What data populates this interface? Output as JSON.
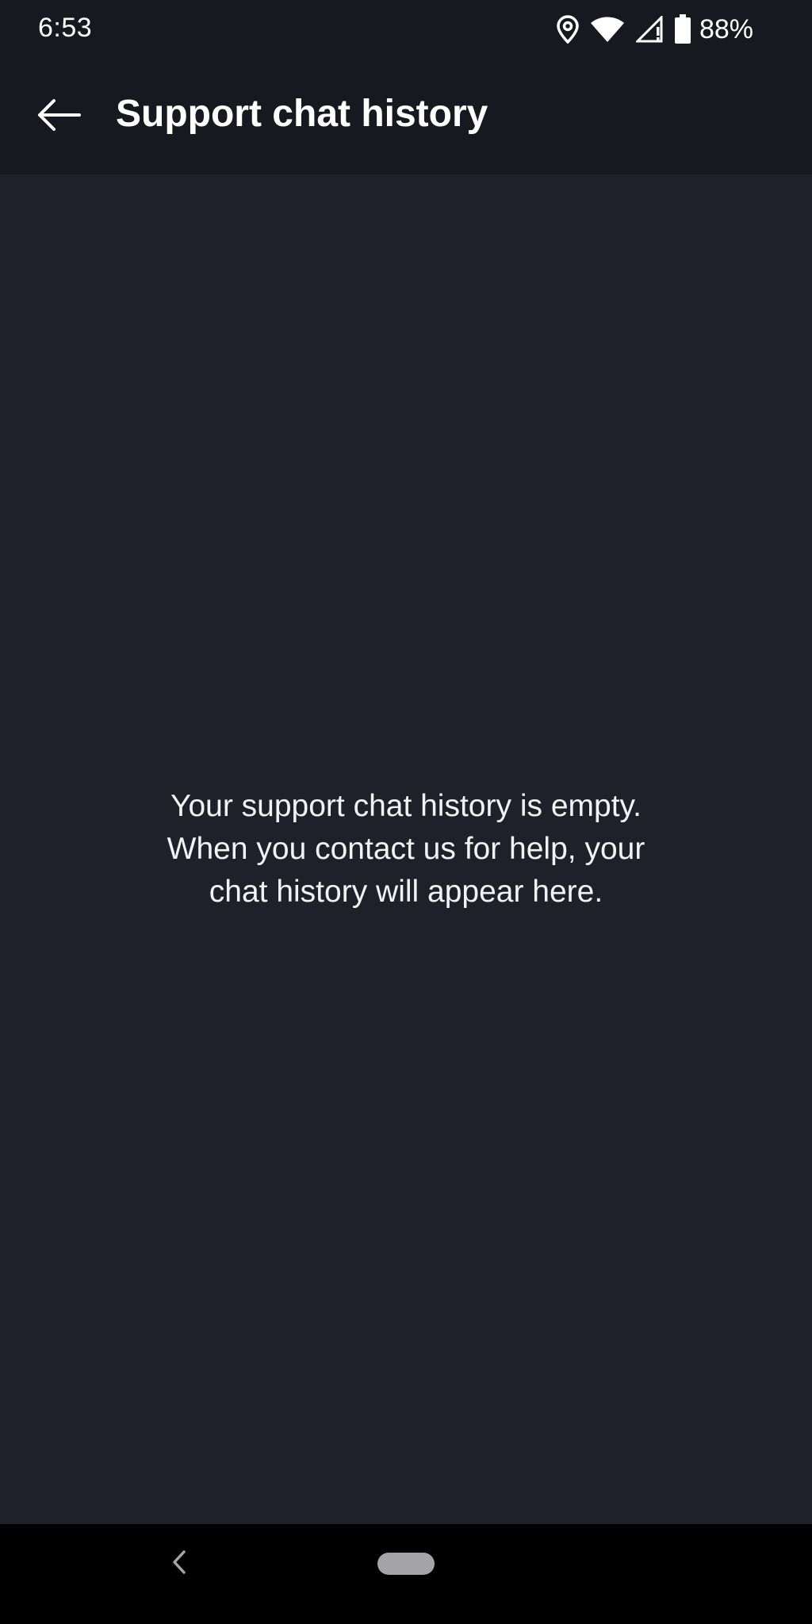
{
  "status_bar": {
    "time": "6:53",
    "battery": "88%",
    "icons": [
      "location-icon",
      "wifi-icon",
      "cellular-signal-icon",
      "battery-icon"
    ]
  },
  "app_bar": {
    "back_icon": "arrow-left-icon",
    "title": "Support chat history"
  },
  "main": {
    "empty_message_lines": [
      "Your support chat history is empty.",
      "When you contact us for help, your",
      "chat history will appear here."
    ]
  },
  "nav_bar": {
    "back_icon": "chevron-left-icon",
    "home_icon": "home-pill-icon"
  },
  "colors": {
    "background": "#20202a",
    "app_bar": "#181820",
    "nav_bar": "#000000",
    "text": "#ffffff"
  }
}
